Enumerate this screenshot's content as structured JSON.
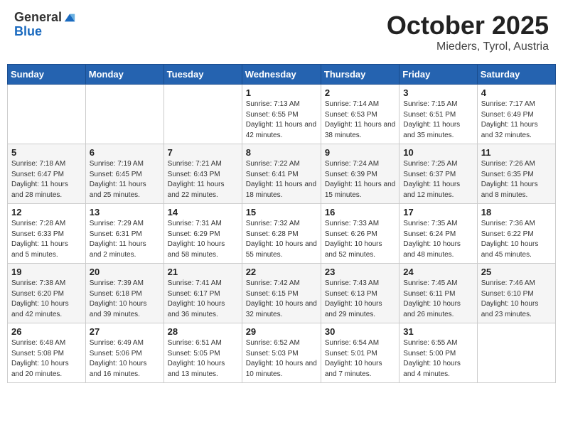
{
  "header": {
    "logo_general": "General",
    "logo_blue": "Blue",
    "month_title": "October 2025",
    "location": "Mieders, Tyrol, Austria"
  },
  "weekdays": [
    "Sunday",
    "Monday",
    "Tuesday",
    "Wednesday",
    "Thursday",
    "Friday",
    "Saturday"
  ],
  "weeks": [
    [
      {
        "day": "",
        "info": ""
      },
      {
        "day": "",
        "info": ""
      },
      {
        "day": "",
        "info": ""
      },
      {
        "day": "1",
        "info": "Sunrise: 7:13 AM\nSunset: 6:55 PM\nDaylight: 11 hours and 42 minutes."
      },
      {
        "day": "2",
        "info": "Sunrise: 7:14 AM\nSunset: 6:53 PM\nDaylight: 11 hours and 38 minutes."
      },
      {
        "day": "3",
        "info": "Sunrise: 7:15 AM\nSunset: 6:51 PM\nDaylight: 11 hours and 35 minutes."
      },
      {
        "day": "4",
        "info": "Sunrise: 7:17 AM\nSunset: 6:49 PM\nDaylight: 11 hours and 32 minutes."
      }
    ],
    [
      {
        "day": "5",
        "info": "Sunrise: 7:18 AM\nSunset: 6:47 PM\nDaylight: 11 hours and 28 minutes."
      },
      {
        "day": "6",
        "info": "Sunrise: 7:19 AM\nSunset: 6:45 PM\nDaylight: 11 hours and 25 minutes."
      },
      {
        "day": "7",
        "info": "Sunrise: 7:21 AM\nSunset: 6:43 PM\nDaylight: 11 hours and 22 minutes."
      },
      {
        "day": "8",
        "info": "Sunrise: 7:22 AM\nSunset: 6:41 PM\nDaylight: 11 hours and 18 minutes."
      },
      {
        "day": "9",
        "info": "Sunrise: 7:24 AM\nSunset: 6:39 PM\nDaylight: 11 hours and 15 minutes."
      },
      {
        "day": "10",
        "info": "Sunrise: 7:25 AM\nSunset: 6:37 PM\nDaylight: 11 hours and 12 minutes."
      },
      {
        "day": "11",
        "info": "Sunrise: 7:26 AM\nSunset: 6:35 PM\nDaylight: 11 hours and 8 minutes."
      }
    ],
    [
      {
        "day": "12",
        "info": "Sunrise: 7:28 AM\nSunset: 6:33 PM\nDaylight: 11 hours and 5 minutes."
      },
      {
        "day": "13",
        "info": "Sunrise: 7:29 AM\nSunset: 6:31 PM\nDaylight: 11 hours and 2 minutes."
      },
      {
        "day": "14",
        "info": "Sunrise: 7:31 AM\nSunset: 6:29 PM\nDaylight: 10 hours and 58 minutes."
      },
      {
        "day": "15",
        "info": "Sunrise: 7:32 AM\nSunset: 6:28 PM\nDaylight: 10 hours and 55 minutes."
      },
      {
        "day": "16",
        "info": "Sunrise: 7:33 AM\nSunset: 6:26 PM\nDaylight: 10 hours and 52 minutes."
      },
      {
        "day": "17",
        "info": "Sunrise: 7:35 AM\nSunset: 6:24 PM\nDaylight: 10 hours and 48 minutes."
      },
      {
        "day": "18",
        "info": "Sunrise: 7:36 AM\nSunset: 6:22 PM\nDaylight: 10 hours and 45 minutes."
      }
    ],
    [
      {
        "day": "19",
        "info": "Sunrise: 7:38 AM\nSunset: 6:20 PM\nDaylight: 10 hours and 42 minutes."
      },
      {
        "day": "20",
        "info": "Sunrise: 7:39 AM\nSunset: 6:18 PM\nDaylight: 10 hours and 39 minutes."
      },
      {
        "day": "21",
        "info": "Sunrise: 7:41 AM\nSunset: 6:17 PM\nDaylight: 10 hours and 36 minutes."
      },
      {
        "day": "22",
        "info": "Sunrise: 7:42 AM\nSunset: 6:15 PM\nDaylight: 10 hours and 32 minutes."
      },
      {
        "day": "23",
        "info": "Sunrise: 7:43 AM\nSunset: 6:13 PM\nDaylight: 10 hours and 29 minutes."
      },
      {
        "day": "24",
        "info": "Sunrise: 7:45 AM\nSunset: 6:11 PM\nDaylight: 10 hours and 26 minutes."
      },
      {
        "day": "25",
        "info": "Sunrise: 7:46 AM\nSunset: 6:10 PM\nDaylight: 10 hours and 23 minutes."
      }
    ],
    [
      {
        "day": "26",
        "info": "Sunrise: 6:48 AM\nSunset: 5:08 PM\nDaylight: 10 hours and 20 minutes."
      },
      {
        "day": "27",
        "info": "Sunrise: 6:49 AM\nSunset: 5:06 PM\nDaylight: 10 hours and 16 minutes."
      },
      {
        "day": "28",
        "info": "Sunrise: 6:51 AM\nSunset: 5:05 PM\nDaylight: 10 hours and 13 minutes."
      },
      {
        "day": "29",
        "info": "Sunrise: 6:52 AM\nSunset: 5:03 PM\nDaylight: 10 hours and 10 minutes."
      },
      {
        "day": "30",
        "info": "Sunrise: 6:54 AM\nSunset: 5:01 PM\nDaylight: 10 hours and 7 minutes."
      },
      {
        "day": "31",
        "info": "Sunrise: 6:55 AM\nSunset: 5:00 PM\nDaylight: 10 hours and 4 minutes."
      },
      {
        "day": "",
        "info": ""
      }
    ]
  ]
}
